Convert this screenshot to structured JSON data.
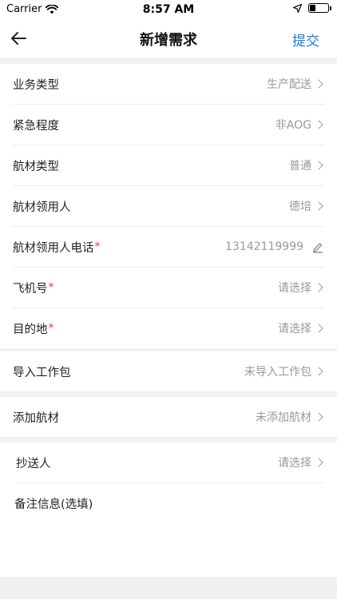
{
  "status": {
    "carrier": "Carrier",
    "time": "8:57 AM",
    "battery_level": 0.3
  },
  "nav": {
    "title": "新增需求",
    "submit": "提交"
  },
  "group1": [
    {
      "label": "业务类型",
      "value": "生产配送",
      "required": false
    },
    {
      "label": "紧急程度",
      "value": "非AOG",
      "required": false
    },
    {
      "label": "航材类型",
      "value": "普通",
      "required": false
    },
    {
      "label": "航材领用人",
      "value": "德培",
      "required": false
    },
    {
      "label": "航材领用人电话",
      "value": "13142119999",
      "required": true
    },
    {
      "label": "飞机号",
      "value": "请选择",
      "required": true
    },
    {
      "label": "目的地",
      "value": "请选择",
      "required": true
    }
  ],
  "required_mark": "*",
  "workpack": {
    "label": "导入工作包",
    "value": "未导入工作包"
  },
  "material": {
    "label": "添加航材",
    "value": "未添加航材"
  },
  "cc": {
    "label": "抄送人",
    "value": "请选择"
  },
  "notes": {
    "label": "备注信息(选填)"
  }
}
